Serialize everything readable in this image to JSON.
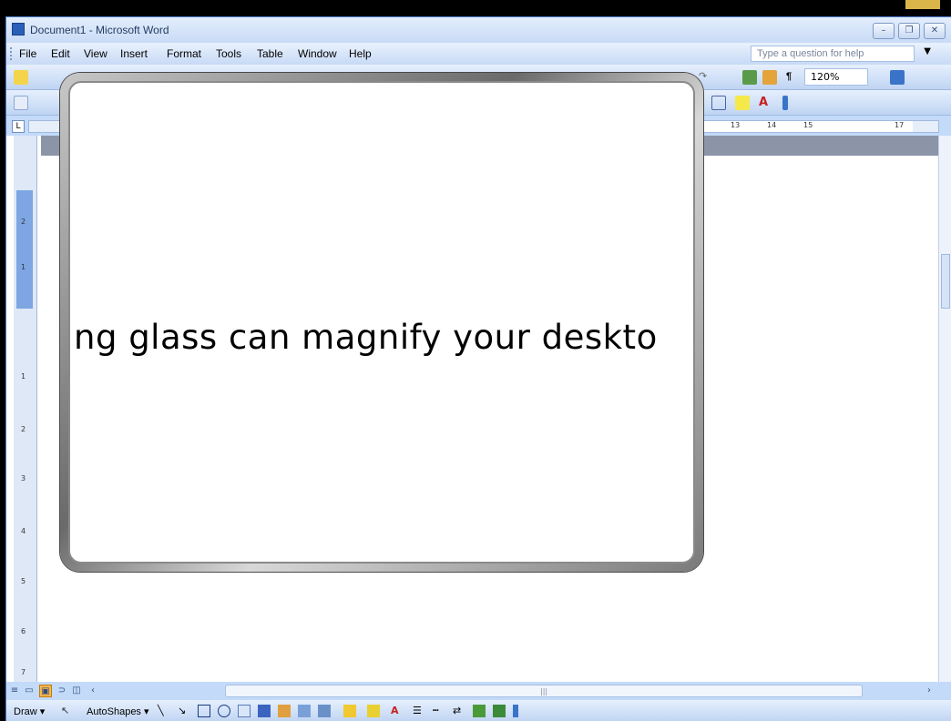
{
  "window": {
    "title": "Document1 - Microsoft Word"
  },
  "menubar": {
    "items": [
      "File",
      "Edit",
      "View",
      "Insert",
      "Format",
      "Tools",
      "Table",
      "Window",
      "Help"
    ],
    "help_placeholder": "Type a question for help"
  },
  "toolbar": {
    "zoom": "120%",
    "pilcrow": "¶"
  },
  "ruler": {
    "numbers": [
      "13",
      "14",
      "15",
      "17"
    ]
  },
  "vruler": {
    "numbers": [
      "2",
      "1",
      "1",
      "2",
      "3",
      "4",
      "5",
      "6",
      "7"
    ]
  },
  "magnifier": {
    "text": "ng glass can magnify your deskto"
  },
  "drawbar": {
    "draw_label": "Draw",
    "autoshapes_label": "AutoShapes"
  },
  "colors": {
    "chrome": "#c3daf9",
    "accent_orange": "#f7b64c"
  }
}
